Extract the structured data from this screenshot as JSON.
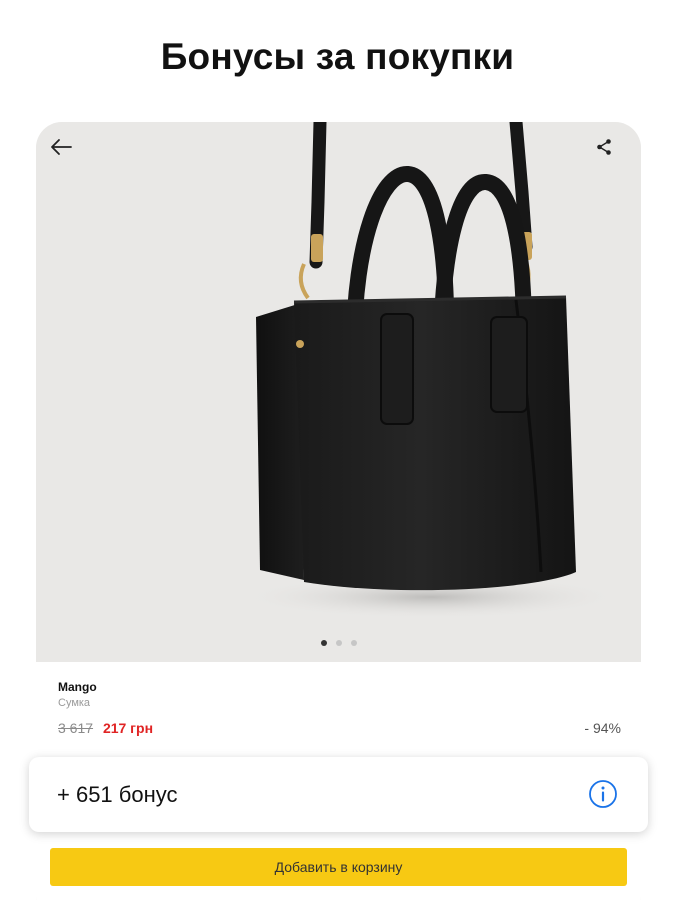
{
  "headline": "Бонусы за покупки",
  "nav": {
    "back_icon": "arrow-left-icon",
    "share_icon": "share-icon"
  },
  "carousel": {
    "total": 3,
    "active_index": 0
  },
  "product": {
    "brand": "Mango",
    "category": "Сумка",
    "old_price": "3 617",
    "new_price": "217 грн",
    "discount": "- 94%",
    "image_subject": "black-leather-tote-bag"
  },
  "bonus": {
    "text": "+ 651 бонус",
    "info_icon": "info-icon"
  },
  "actions": {
    "add_to_cart_label": "Добавить в корзину"
  },
  "colors": {
    "accent_yellow": "#f7c913",
    "sale_red": "#e02424",
    "info_blue": "#1a73e8"
  }
}
